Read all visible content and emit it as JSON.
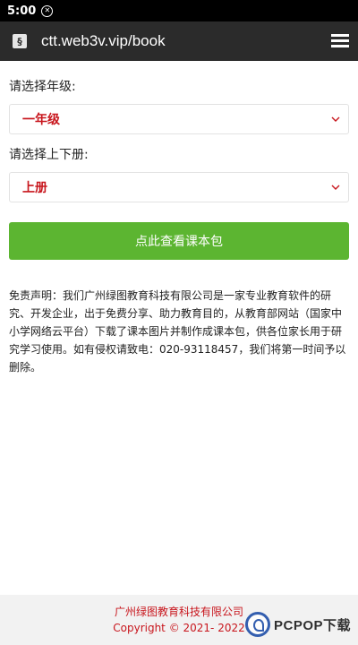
{
  "status_bar": {
    "time": "5:00"
  },
  "browser": {
    "url": "ctt.web3v.vip/book"
  },
  "form": {
    "grade_label": "请选择年级:",
    "grade_value": "一年级",
    "volume_label": "请选择上下册:",
    "volume_value": "上册",
    "submit_label": "点此查看课本包"
  },
  "disclaimer": "免责声明：我们广州绿图教育科技有限公司是一家专业教育软件的研究、开发企业，出于免费分享、助力教育目的，从教育部网站（国家中小学网络云平台）下载了课本图片并制作成课本包，供各位家长用于研究学习使用。如有侵权请致电：020-93118457，我们将第一时间予以删除。",
  "footer": {
    "company": "广州绿图教育科技有限公司",
    "copyright": "Copyright © 2021- 2022"
  },
  "watermark": {
    "text": "PCPOP下载"
  },
  "colors": {
    "accent_green": "#5cb531",
    "accent_red": "#c8161d",
    "browser_bar": "#2b2b2b"
  }
}
